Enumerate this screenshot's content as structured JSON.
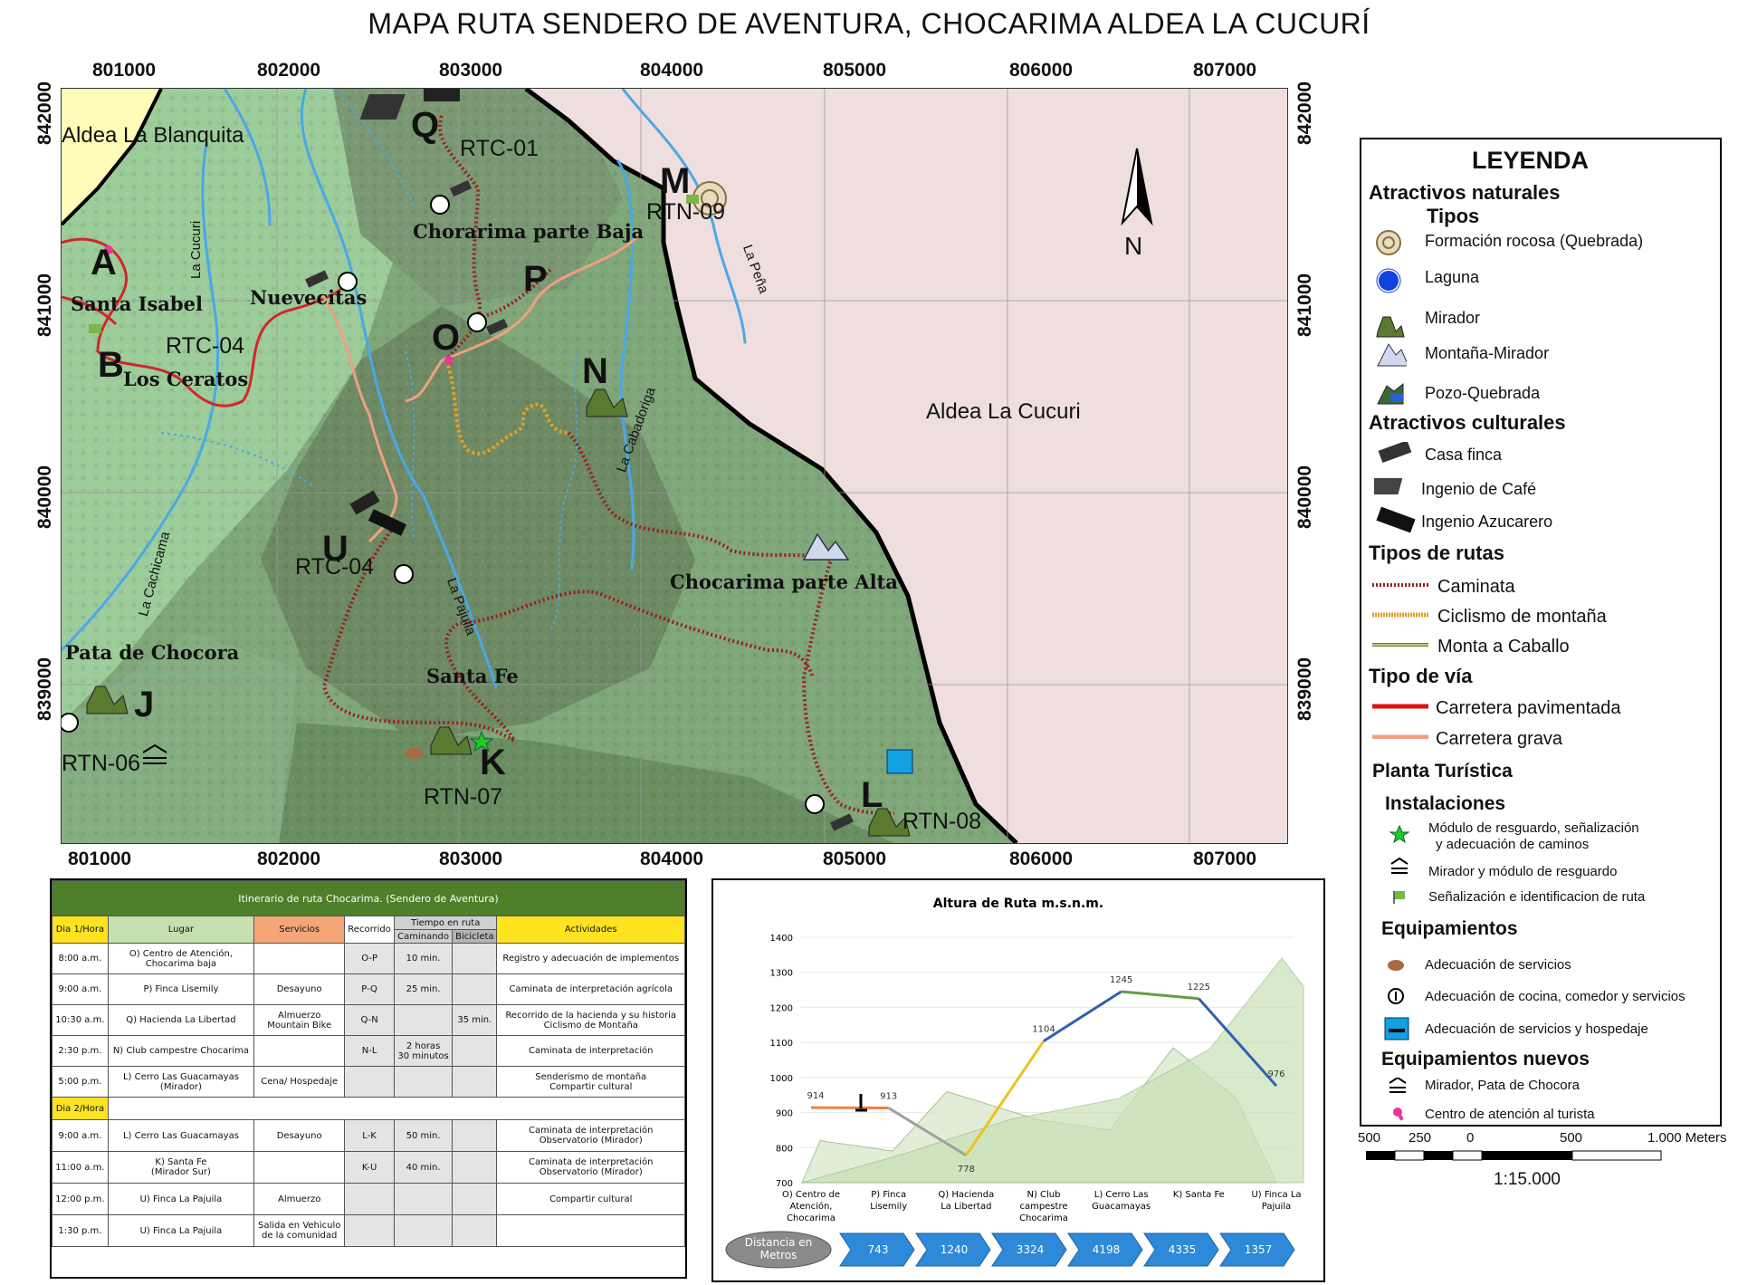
{
  "title": "MAPA RUTA SENDERO DE AVENTURA, CHOCARIMA ALDEA LA CUCURÍ",
  "map": {
    "x_ticks": [
      "801000",
      "802000",
      "803000",
      "804000",
      "805000",
      "806000",
      "807000"
    ],
    "y_ticks": [
      "842000",
      "841000",
      "840000",
      "839000"
    ],
    "north_label": "N",
    "areas": {
      "blanquita": "Aldea La Blanquita",
      "cucuri": "Aldea La Cucuri"
    },
    "places": {
      "santa_isabel": "Santa Isabel",
      "nuevecitas": "Nuevecitas",
      "los_ceratos": "Los Ceratos",
      "chorarima_baja": "Chorarima parte Baja",
      "chocarima_alta": "Chocarima parte Alta",
      "santa_fe": "Santa Fe",
      "pata_chocora": "Pata de Chocora"
    },
    "streams": {
      "la_cucuri": "La Cucuri",
      "la_pena": "La Peña",
      "la_cabadoriga": "La Cabadoriga",
      "la_cachicama": "La Cachicama",
      "la_pajuila": "La Pajuila"
    },
    "points": {
      "A": "A",
      "B": "B",
      "J": "J",
      "K": "K",
      "L": "L",
      "M": "M",
      "N": "N",
      "O": "O",
      "P": "P",
      "Q": "Q",
      "U": "U"
    },
    "codes": {
      "rtc01": "RTC-01",
      "rtc04a": "RTC-04",
      "rtc04b": "RTC-04",
      "rtn09": "RTN-09",
      "rtn06": "RTN-06",
      "rtn07": "RTN-07",
      "rtn08": "RTN-08"
    }
  },
  "legend": {
    "title": "LEYENDA",
    "natural_title": "Atractivos naturales",
    "tipos_title": "Tipos",
    "natural_items": [
      "Formación rocosa (Quebrada)",
      "Laguna",
      "Mirador",
      "Montaña-Mirador",
      "Pozo-Quebrada"
    ],
    "cultural_title": "Atractivos culturales",
    "cultural_items": [
      "Casa finca",
      "Ingenio de Café",
      "Ingenio Azucarero"
    ],
    "route_title": "Tipos de rutas",
    "route_items": [
      "Caminata",
      "Ciclismo de montaña",
      "Monta a Caballo"
    ],
    "via_title": "Tipo de vía",
    "via_items": [
      "Carretera pavimentada",
      "Carretera grava"
    ],
    "planta_title": "Planta Turística",
    "instal_title": "Instalaciones",
    "instal_items": [
      "Módulo de resguardo, señalización",
      "y adecuación de caminos",
      "Mirador y módulo de resguardo",
      "Señalización e identificacion de ruta"
    ],
    "equip_title": "Equipamientos",
    "equip_items": [
      "Adecuación de servicios",
      "Adecuación de cocina, comedor y servicios",
      "Adecuación de servicios y hospedaje"
    ],
    "nuevos_title": "Equipamientos nuevos",
    "nuevos_items": [
      "Mirador, Pata de Chocora",
      "Centro de atención al turista"
    ],
    "colors": {
      "caminata": "#9b1c1c",
      "ciclismo": "#e0a030",
      "caballo": "#6b7a2a",
      "pavimentada": "#e01010",
      "grava": "#f0a080"
    }
  },
  "scalebar": {
    "labels": [
      "500",
      "250",
      "0",
      "500",
      "1.000 Meters"
    ],
    "ratio": "1:15.000"
  },
  "itinerary": {
    "title": "Itinerario de ruta Chocarima. (Sendero de Aventura)",
    "headers": {
      "dia1": "Dia 1/Hora",
      "lugar": "Lugar",
      "servicios": "Servicios",
      "recorrido": "Recorrido",
      "tiempo": "Tiempo en ruta",
      "caminando": "Caminando",
      "bicicleta": "Bicicleta",
      "actividades": "Actividades",
      "dia2": "Dia 2/Hora"
    },
    "day1": [
      {
        "hora": "8:00 a.m.",
        "lugar1": "O) Centro de Atención,",
        "lugar2": "Chocarima baja",
        "serv1": "",
        "serv2": "",
        "rec": "O-P",
        "cam1": "10 min.",
        "cam2": "",
        "bic": "",
        "act1": "Registro y adecuación de implementos",
        "act2": ""
      },
      {
        "hora": "9:00 a.m.",
        "lugar1": "P) Finca Lisemily",
        "lugar2": "",
        "serv1": "Desayuno",
        "serv2": "",
        "rec": "P-Q",
        "cam1": "25 min.",
        "cam2": "",
        "bic": "",
        "act1": "Caminata de interpretación agrícola",
        "act2": ""
      },
      {
        "hora": "10:30 a.m.",
        "lugar1": "Q) Hacienda La Libertad",
        "lugar2": "",
        "serv1": "Almuerzo",
        "serv2": "Mountain Bike",
        "rec": "Q-N",
        "cam1": "",
        "cam2": "",
        "bic": "35 min.",
        "act1": "Recorrido de la hacienda y su historia",
        "act2": "Ciclismo de Montaña"
      },
      {
        "hora": "2:30 p.m.",
        "lugar1": "N) Club campestre Chocarima",
        "lugar2": "",
        "serv1": "",
        "serv2": "",
        "rec": "N-L",
        "cam1": "2 horas",
        "cam2": "30 minutos",
        "bic": "",
        "act1": "Caminata de interpretación",
        "act2": ""
      },
      {
        "hora": "5:00 p.m.",
        "lugar1": "L) Cerro Las Guacamayas",
        "lugar2": "(Mirador)",
        "serv1": "Cena/ Hospedaje",
        "serv2": "",
        "rec": "",
        "cam1": "",
        "cam2": "",
        "bic": "",
        "act1": "Senderismo de montaña",
        "act2": "Compartir cultural"
      }
    ],
    "day2": [
      {
        "hora": "9:00 a.m.",
        "lugar1": "L) Cerro Las Guacamayas",
        "lugar2": "",
        "serv1": "Desayuno",
        "serv2": "",
        "rec": "L-K",
        "cam1": "50 min.",
        "cam2": "",
        "bic": "",
        "act1": "Caminata de interpretación",
        "act2": "Observatorio (Mirador)"
      },
      {
        "hora": "11:00 a.m.",
        "lugar1": "K) Santa Fe",
        "lugar2": "(Mirador Sur)",
        "serv1": "",
        "serv2": "",
        "rec": "K-U",
        "cam1": "40 min.",
        "cam2": "",
        "bic": "",
        "act1": "Caminata de interpretación",
        "act2": "Observatorio (Mirador)"
      },
      {
        "hora": "12:00 p.m.",
        "lugar1": "U) Finca La Pajuila",
        "lugar2": "",
        "serv1": "Almuerzo",
        "serv2": "",
        "rec": "",
        "cam1": "",
        "cam2": "",
        "bic": "",
        "act1": "Compartir cultural",
        "act2": ""
      },
      {
        "hora": "1:30 p.m.",
        "lugar1": "U) Finca La Pajuila",
        "lugar2": "",
        "serv1": "Salida en Vehiculo",
        "serv2": "de la comunidad",
        "rec": "",
        "cam1": "",
        "cam2": "",
        "bic": "",
        "act1": "",
        "act2": ""
      }
    ]
  },
  "chart_data": {
    "type": "line",
    "title": "Altura de Ruta m.s.n.m.",
    "categories": [
      "O) Centro de Atención, Chocarima",
      "P) Finca Lisemily",
      "Q) Hacienda La Libertad",
      "N) Club campestre Chocarima",
      "L) Cerro Las Guacamayas",
      "K) Santa Fe",
      "U) Finca La Pajuila"
    ],
    "series": [
      {
        "values": [
          914,
          913,
          778,
          1104,
          1245,
          1225,
          976
        ]
      }
    ],
    "segment_colors": [
      "#f08040",
      "#a0a0a0",
      "#f0c020",
      "#3060b0",
      "#60a040",
      "#3060b0"
    ],
    "ylim": [
      700,
      1400
    ],
    "yticks": [
      700,
      800,
      900,
      1000,
      1100,
      1200,
      1300,
      1400
    ],
    "distance_label": "Distancia en Metros",
    "distances": [
      "743",
      "1240",
      "3324",
      "4198",
      "4335",
      "1357"
    ]
  }
}
